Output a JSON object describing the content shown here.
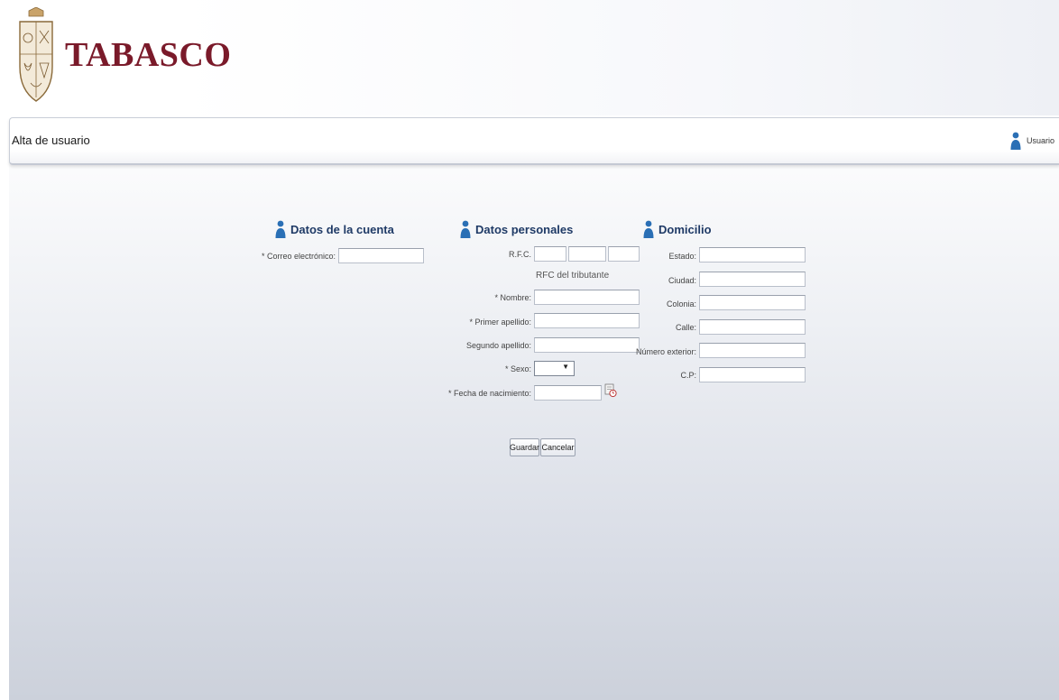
{
  "header": {
    "brand": "TABASCO"
  },
  "titlebar": {
    "title": "Alta de usuario",
    "user_label": "Usuario"
  },
  "sections": {
    "account": {
      "title": "Datos de la cuenta"
    },
    "personal": {
      "title": "Datos personales"
    },
    "address": {
      "title": "Domicilio"
    }
  },
  "account": {
    "email_label": "* Correo electrónico:",
    "email_value": ""
  },
  "personal": {
    "rfc_label": "R.F.C.",
    "rfc_hint": "RFC del tributante",
    "nombre_label": "* Nombre:",
    "primer_apellido_label": "* Primer apellido:",
    "segundo_apellido_label": "Segundo apellido:",
    "sexo_label": "* Sexo:",
    "sexo_value": "",
    "fecha_label": "* Fecha de nacimiento:"
  },
  "address": {
    "estado_label": "Estado:",
    "ciudad_label": "Ciudad:",
    "colonia_label": "Colonia:",
    "calle_label": "Calle:",
    "numero_label": "Número exterior:",
    "cp_label": "C.P:"
  },
  "buttons": {
    "save": "Guardar",
    "cancel": "Cancelar"
  },
  "icons": {
    "logo": "tabasco-shield-icon",
    "user": "user-icon",
    "calendar": "calendar-icon"
  },
  "colors": {
    "brand": "#7a1a2a",
    "section_title": "#1f3a66",
    "person_icon": "#2a6fb5"
  }
}
